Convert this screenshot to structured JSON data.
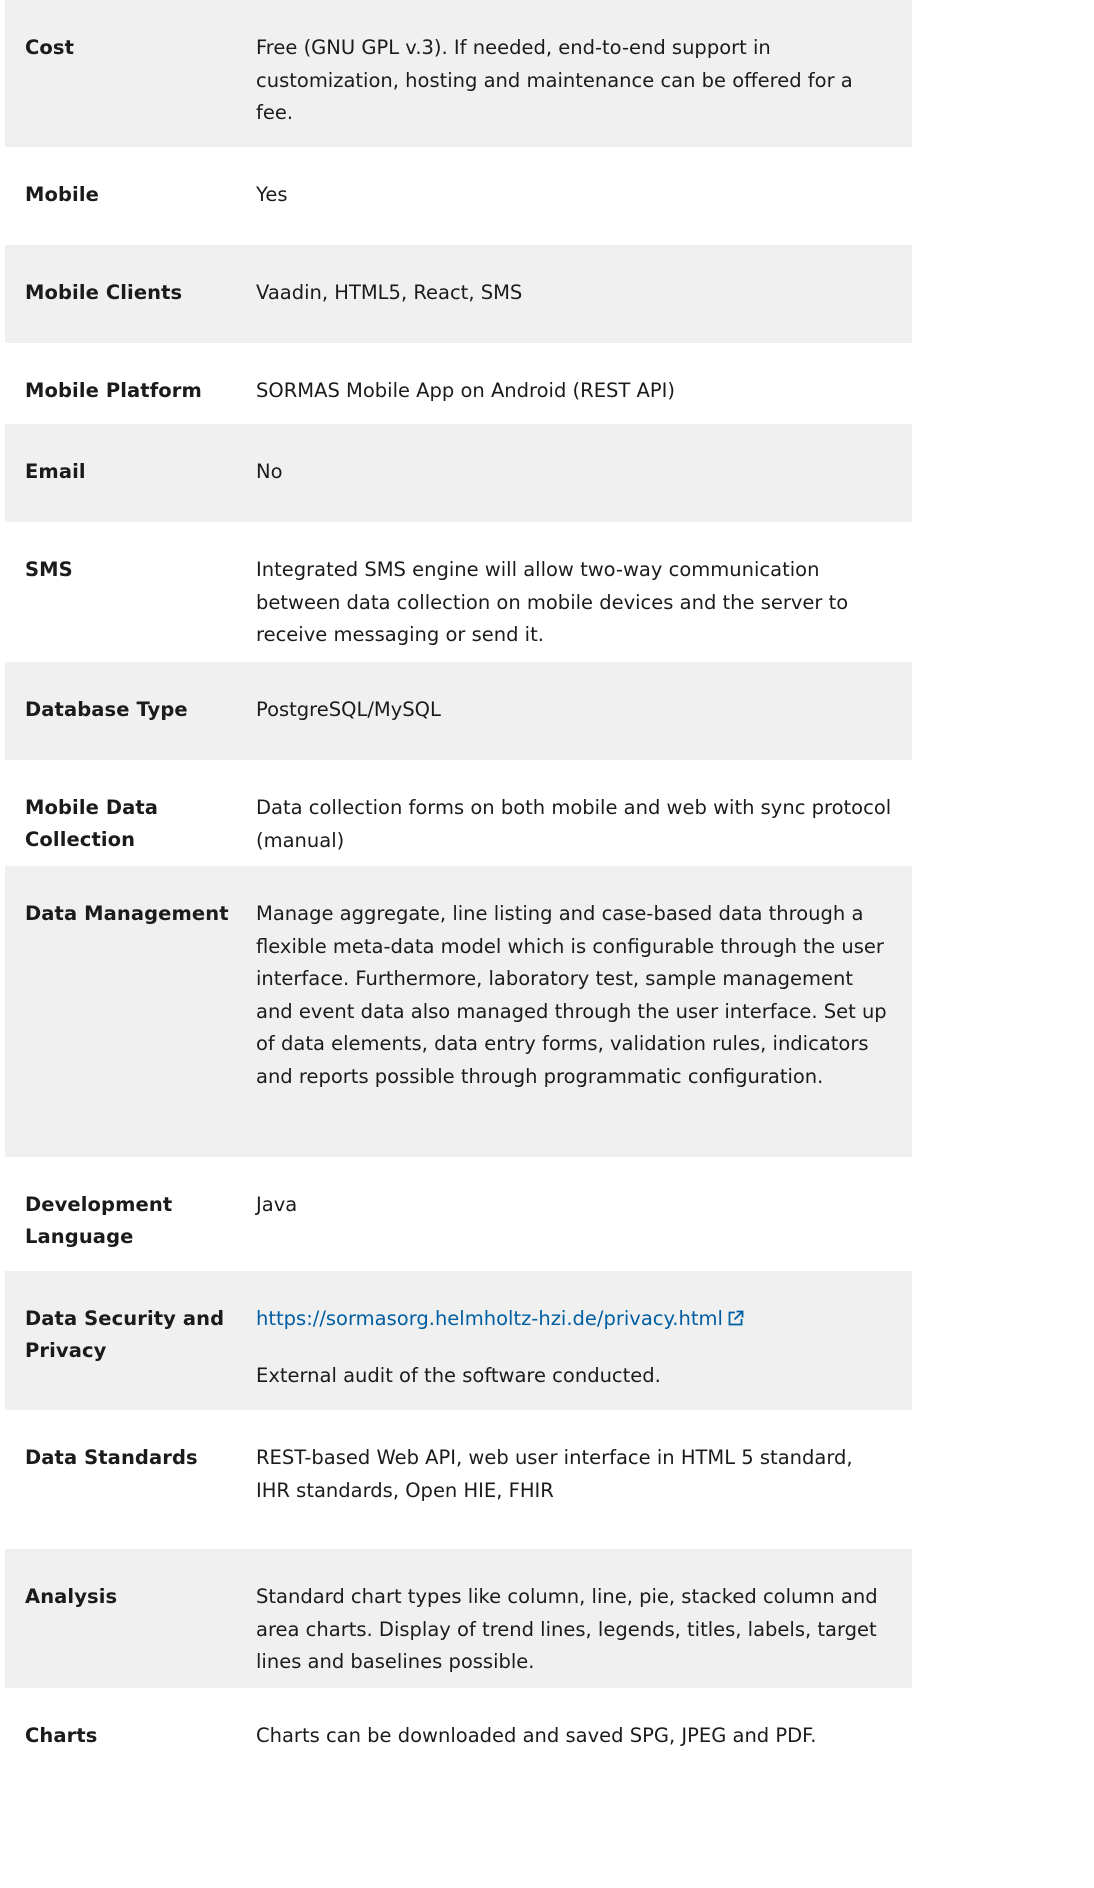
{
  "rows": [
    {
      "label": "Cost",
      "value": "Free (GNU GPL v.3).  If needed, end-to-end support in customization, hosting and maintenance can be offered for a fee."
    },
    {
      "label": "Mobile",
      "value": "Yes"
    },
    {
      "label": "Mobile Clients",
      "value": "Vaadin, HTML5, React, SMS"
    },
    {
      "label": "Mobile Platform",
      "value": "SORMAS Mobile App on Android (REST API)"
    },
    {
      "label": "Email",
      "value": "No"
    },
    {
      "label": "SMS",
      "value": "Integrated SMS engine will allow two-way communication between data collection on mobile devices and the server to receive messaging or send it."
    },
    {
      "label": "Database Type",
      "value": "PostgreSQL/MySQL"
    },
    {
      "label": "Mobile Data Collection",
      "value": "Data collection forms on both mobile and web with sync protocol (manual)"
    },
    {
      "label": "Data Management",
      "value": "Manage aggregate, line listing and case-based data through a flexible meta-data model which is configurable through the user interface. Furthermore, laboratory test, sample management and event data also managed through the user interface.  Set up of data elements, data entry forms, validation rules, indicators and reports possible through programmatic configuration."
    },
    {
      "label": "Development Language",
      "value": "Java"
    },
    {
      "label": "Data Security and Privacy",
      "link": "https://sormasorg.helmholtz-hzi.de/privacy.html",
      "link_icon": "external-link-icon",
      "value": "External audit of the software conducted."
    },
    {
      "label": "Data Standards",
      "value": "REST-based Web API, web user interface in HTML 5 standard, IHR standards, Open HIE, FHIR"
    },
    {
      "label": "Analysis",
      "value": "Standard chart types like column, line, pie, stacked column and area charts. Display of trend lines, legends, titles, labels, target lines and baselines possible."
    },
    {
      "label": "Charts",
      "value": "Charts can be downloaded and saved SPG, JPEG and PDF."
    }
  ],
  "colors": {
    "shaded_row": "#f0f0f0",
    "text": "#1b1b1b",
    "link": "#005ea2"
  }
}
